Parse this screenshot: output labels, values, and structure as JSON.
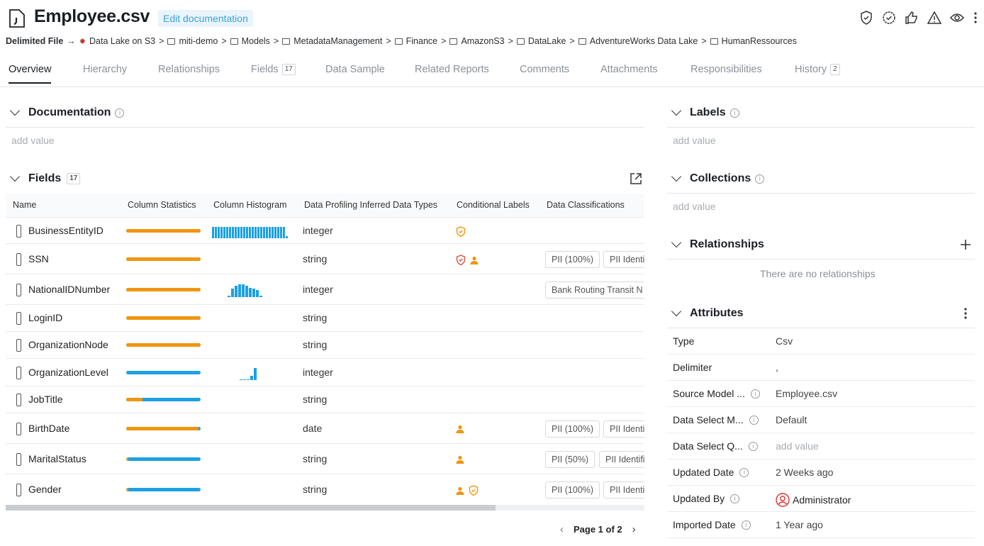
{
  "header": {
    "title": "Employee.csv",
    "edit_doc": "Edit documentation"
  },
  "breadcrumb": {
    "type": "Delimited File",
    "source": "Data Lake on S3",
    "items": [
      "miti-demo",
      "Models",
      "MetadataManagement",
      "Finance",
      "AmazonS3",
      "DataLake",
      "AdventureWorks Data Lake",
      "HumanRessources"
    ]
  },
  "tabs": [
    {
      "label": "Overview"
    },
    {
      "label": "Hierarchy"
    },
    {
      "label": "Relationships"
    },
    {
      "label": "Fields",
      "count": "17"
    },
    {
      "label": "Data Sample"
    },
    {
      "label": "Related Reports"
    },
    {
      "label": "Comments"
    },
    {
      "label": "Attachments"
    },
    {
      "label": "Responsibilities"
    },
    {
      "label": "History",
      "count": "2"
    }
  ],
  "documentation": {
    "title": "Documentation",
    "placeholder": "add value"
  },
  "fields": {
    "title": "Fields",
    "count": "17",
    "columns": [
      "Name",
      "Column Statistics",
      "Column Histogram",
      "Data Profiling Inferred Data Types",
      "Conditional Labels",
      "Data Classifications"
    ],
    "rows": [
      {
        "name": "BusinessEntityID",
        "type": "integer",
        "orange_fraction": 1.0,
        "labels": [
          "shield"
        ],
        "chips": []
      },
      {
        "name": "SSN",
        "type": "string",
        "orange_fraction": 1.0,
        "labels": [
          "shield-red",
          "person"
        ],
        "chips": [
          "PII (100%)",
          "PII Identi"
        ]
      },
      {
        "name": "NationalIDNumber",
        "type": "integer",
        "orange_fraction": 1.0,
        "labels": [],
        "chips": [
          "Bank Routing Transit N"
        ]
      },
      {
        "name": "LoginID",
        "type": "string",
        "orange_fraction": 1.0,
        "labels": [],
        "chips": []
      },
      {
        "name": "OrganizationNode",
        "type": "string",
        "orange_fraction": 1.0,
        "labels": [],
        "chips": []
      },
      {
        "name": "OrganizationLevel",
        "type": "integer",
        "orange_fraction": 0.0,
        "labels": [],
        "chips": []
      },
      {
        "name": "JobTitle",
        "type": "string",
        "orange_fraction": 0.22,
        "labels": [],
        "chips": []
      },
      {
        "name": "BirthDate",
        "type": "date",
        "orange_fraction": 0.97,
        "labels": [
          "person"
        ],
        "chips": [
          "PII (100%)",
          "PII Identi"
        ]
      },
      {
        "name": "MaritalStatus",
        "type": "string",
        "orange_fraction": 0.03,
        "labels": [
          "person"
        ],
        "chips": [
          "PII (50%)",
          "PII Identifi"
        ]
      },
      {
        "name": "Gender",
        "type": "string",
        "orange_fraction": 0.03,
        "labels": [
          "person",
          "shield"
        ],
        "chips": [
          "PII (100%)",
          "PII Identi"
        ]
      }
    ],
    "pager": "Page 1 of 2"
  },
  "right": {
    "labels": {
      "title": "Labels",
      "placeholder": "add value"
    },
    "collections": {
      "title": "Collections",
      "placeholder": "add value"
    },
    "relationships": {
      "title": "Relationships",
      "empty": "There are no relationships"
    },
    "attributes": {
      "title": "Attributes",
      "items": [
        {
          "key": "Type",
          "value": "Csv",
          "info": false
        },
        {
          "key": "Delimiter",
          "value": ",",
          "info": false
        },
        {
          "key": "Source Model ...",
          "value": "Employee.csv",
          "info": true
        },
        {
          "key": "Data Select M...",
          "value": "Default",
          "info": true
        },
        {
          "key": "Data Select Q...",
          "value": "add value",
          "info": true,
          "placeholder": true
        },
        {
          "key": "Updated Date",
          "value": "2 Weeks ago",
          "info": true
        },
        {
          "key": "Updated By",
          "value": "Administrator",
          "info": true,
          "avatar": true
        },
        {
          "key": "Imported Date",
          "value": "1 Year ago",
          "info": true
        }
      ]
    }
  },
  "colors": {
    "orange": "#f0950e",
    "blue": "#1ca1e2",
    "accent": "#3ba3d8"
  }
}
